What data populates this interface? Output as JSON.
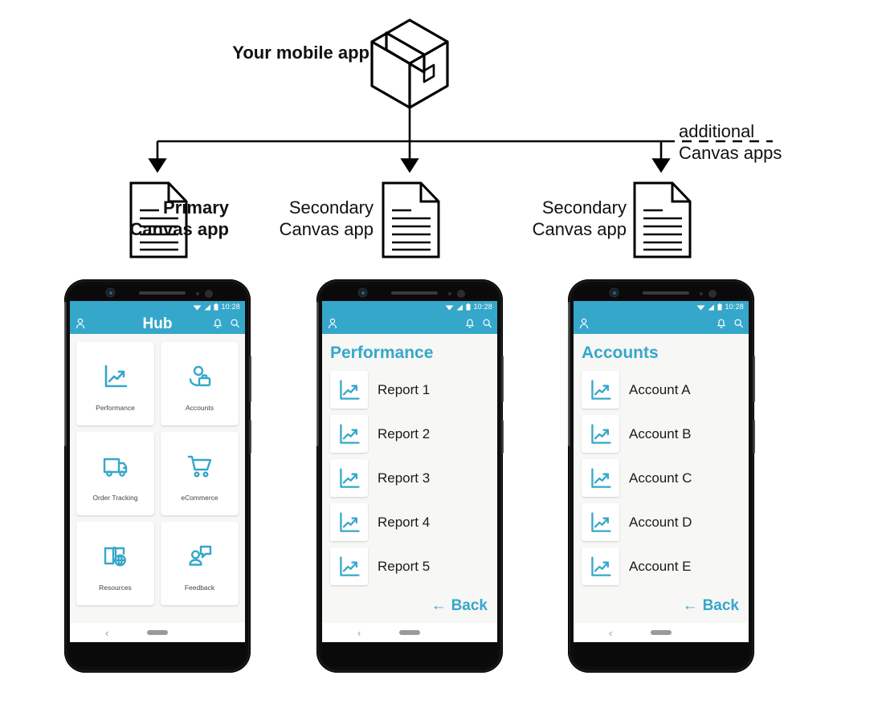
{
  "colors": {
    "accent": "#35a7ca",
    "icon_blue": "#35a7ca",
    "line": "#000000",
    "screen_bg": "#f7f7f5",
    "tile_bg": "#ffffff"
  },
  "diagram": {
    "root": {
      "label": "Your mobile app",
      "icon": "box-icon"
    },
    "branches": [
      {
        "label": "Primary\nCanvas app",
        "label_line1": "Primary",
        "label_line2": "Canvas app",
        "bold": true,
        "icon": "document-icon"
      },
      {
        "label": "Secondary\nCanvas app",
        "label_line1": "Secondary",
        "label_line2": "Canvas app",
        "bold": false,
        "icon": "document-icon"
      },
      {
        "label": "Secondary\nCanvas app",
        "label_line1": "Secondary",
        "label_line2": "Canvas app",
        "bold": false,
        "icon": "document-icon"
      }
    ],
    "dashed_note": {
      "line1": "additional",
      "line2": "Canvas apps"
    }
  },
  "phones": [
    {
      "id": "phone-hub",
      "status": {
        "time": "10:28",
        "icons": [
          "wifi-icon",
          "signal-icon",
          "battery-icon"
        ]
      },
      "appbar": {
        "title": "Hub",
        "left_icon": "person-icon",
        "right_icons": [
          "bell-icon",
          "search-icon"
        ]
      },
      "tiles": [
        {
          "label": "Performance",
          "icon": "chart-trend-icon"
        },
        {
          "label": "Accounts",
          "icon": "person-briefcase-icon"
        },
        {
          "label": "Order Tracking",
          "icon": "truck-icon"
        },
        {
          "label": "eCommerce",
          "icon": "shopping-cart-icon"
        },
        {
          "label": "Resources",
          "icon": "book-globe-icon"
        },
        {
          "label": "Feedback",
          "icon": "person-speech-icon"
        }
      ],
      "navbar": {
        "back_glyph": "‹",
        "home_pill": true
      }
    },
    {
      "id": "phone-performance",
      "status": {
        "time": "10:28",
        "icons": [
          "wifi-icon",
          "signal-icon",
          "battery-icon"
        ]
      },
      "appbar": {
        "title": "",
        "left_icon": "person-icon",
        "right_icons": [
          "bell-icon",
          "search-icon"
        ]
      },
      "page_title": "Performance",
      "list": [
        {
          "label": "Report 1",
          "icon": "chart-trend-icon"
        },
        {
          "label": "Report 2",
          "icon": "chart-trend-icon"
        },
        {
          "label": "Report 3",
          "icon": "chart-trend-icon"
        },
        {
          "label": "Report 4",
          "icon": "chart-trend-icon"
        },
        {
          "label": "Report 5",
          "icon": "chart-trend-icon"
        }
      ],
      "back": {
        "arrow": "←",
        "label": "Back"
      },
      "navbar": {
        "back_glyph": "‹",
        "home_pill": true
      }
    },
    {
      "id": "phone-accounts",
      "status": {
        "time": "10:28",
        "icons": [
          "wifi-icon",
          "signal-icon",
          "battery-icon"
        ]
      },
      "appbar": {
        "title": "",
        "left_icon": "person-icon",
        "right_icons": [
          "bell-icon",
          "search-icon"
        ]
      },
      "page_title": "Accounts",
      "list": [
        {
          "label": "Account A",
          "icon": "chart-trend-icon"
        },
        {
          "label": "Account B",
          "icon": "chart-trend-icon"
        },
        {
          "label": "Account C",
          "icon": "chart-trend-icon"
        },
        {
          "label": "Account D",
          "icon": "chart-trend-icon"
        },
        {
          "label": "Account E",
          "icon": "chart-trend-icon"
        }
      ],
      "back": {
        "arrow": "←",
        "label": "Back"
      },
      "navbar": {
        "back_glyph": "‹",
        "home_pill": true
      }
    }
  ]
}
